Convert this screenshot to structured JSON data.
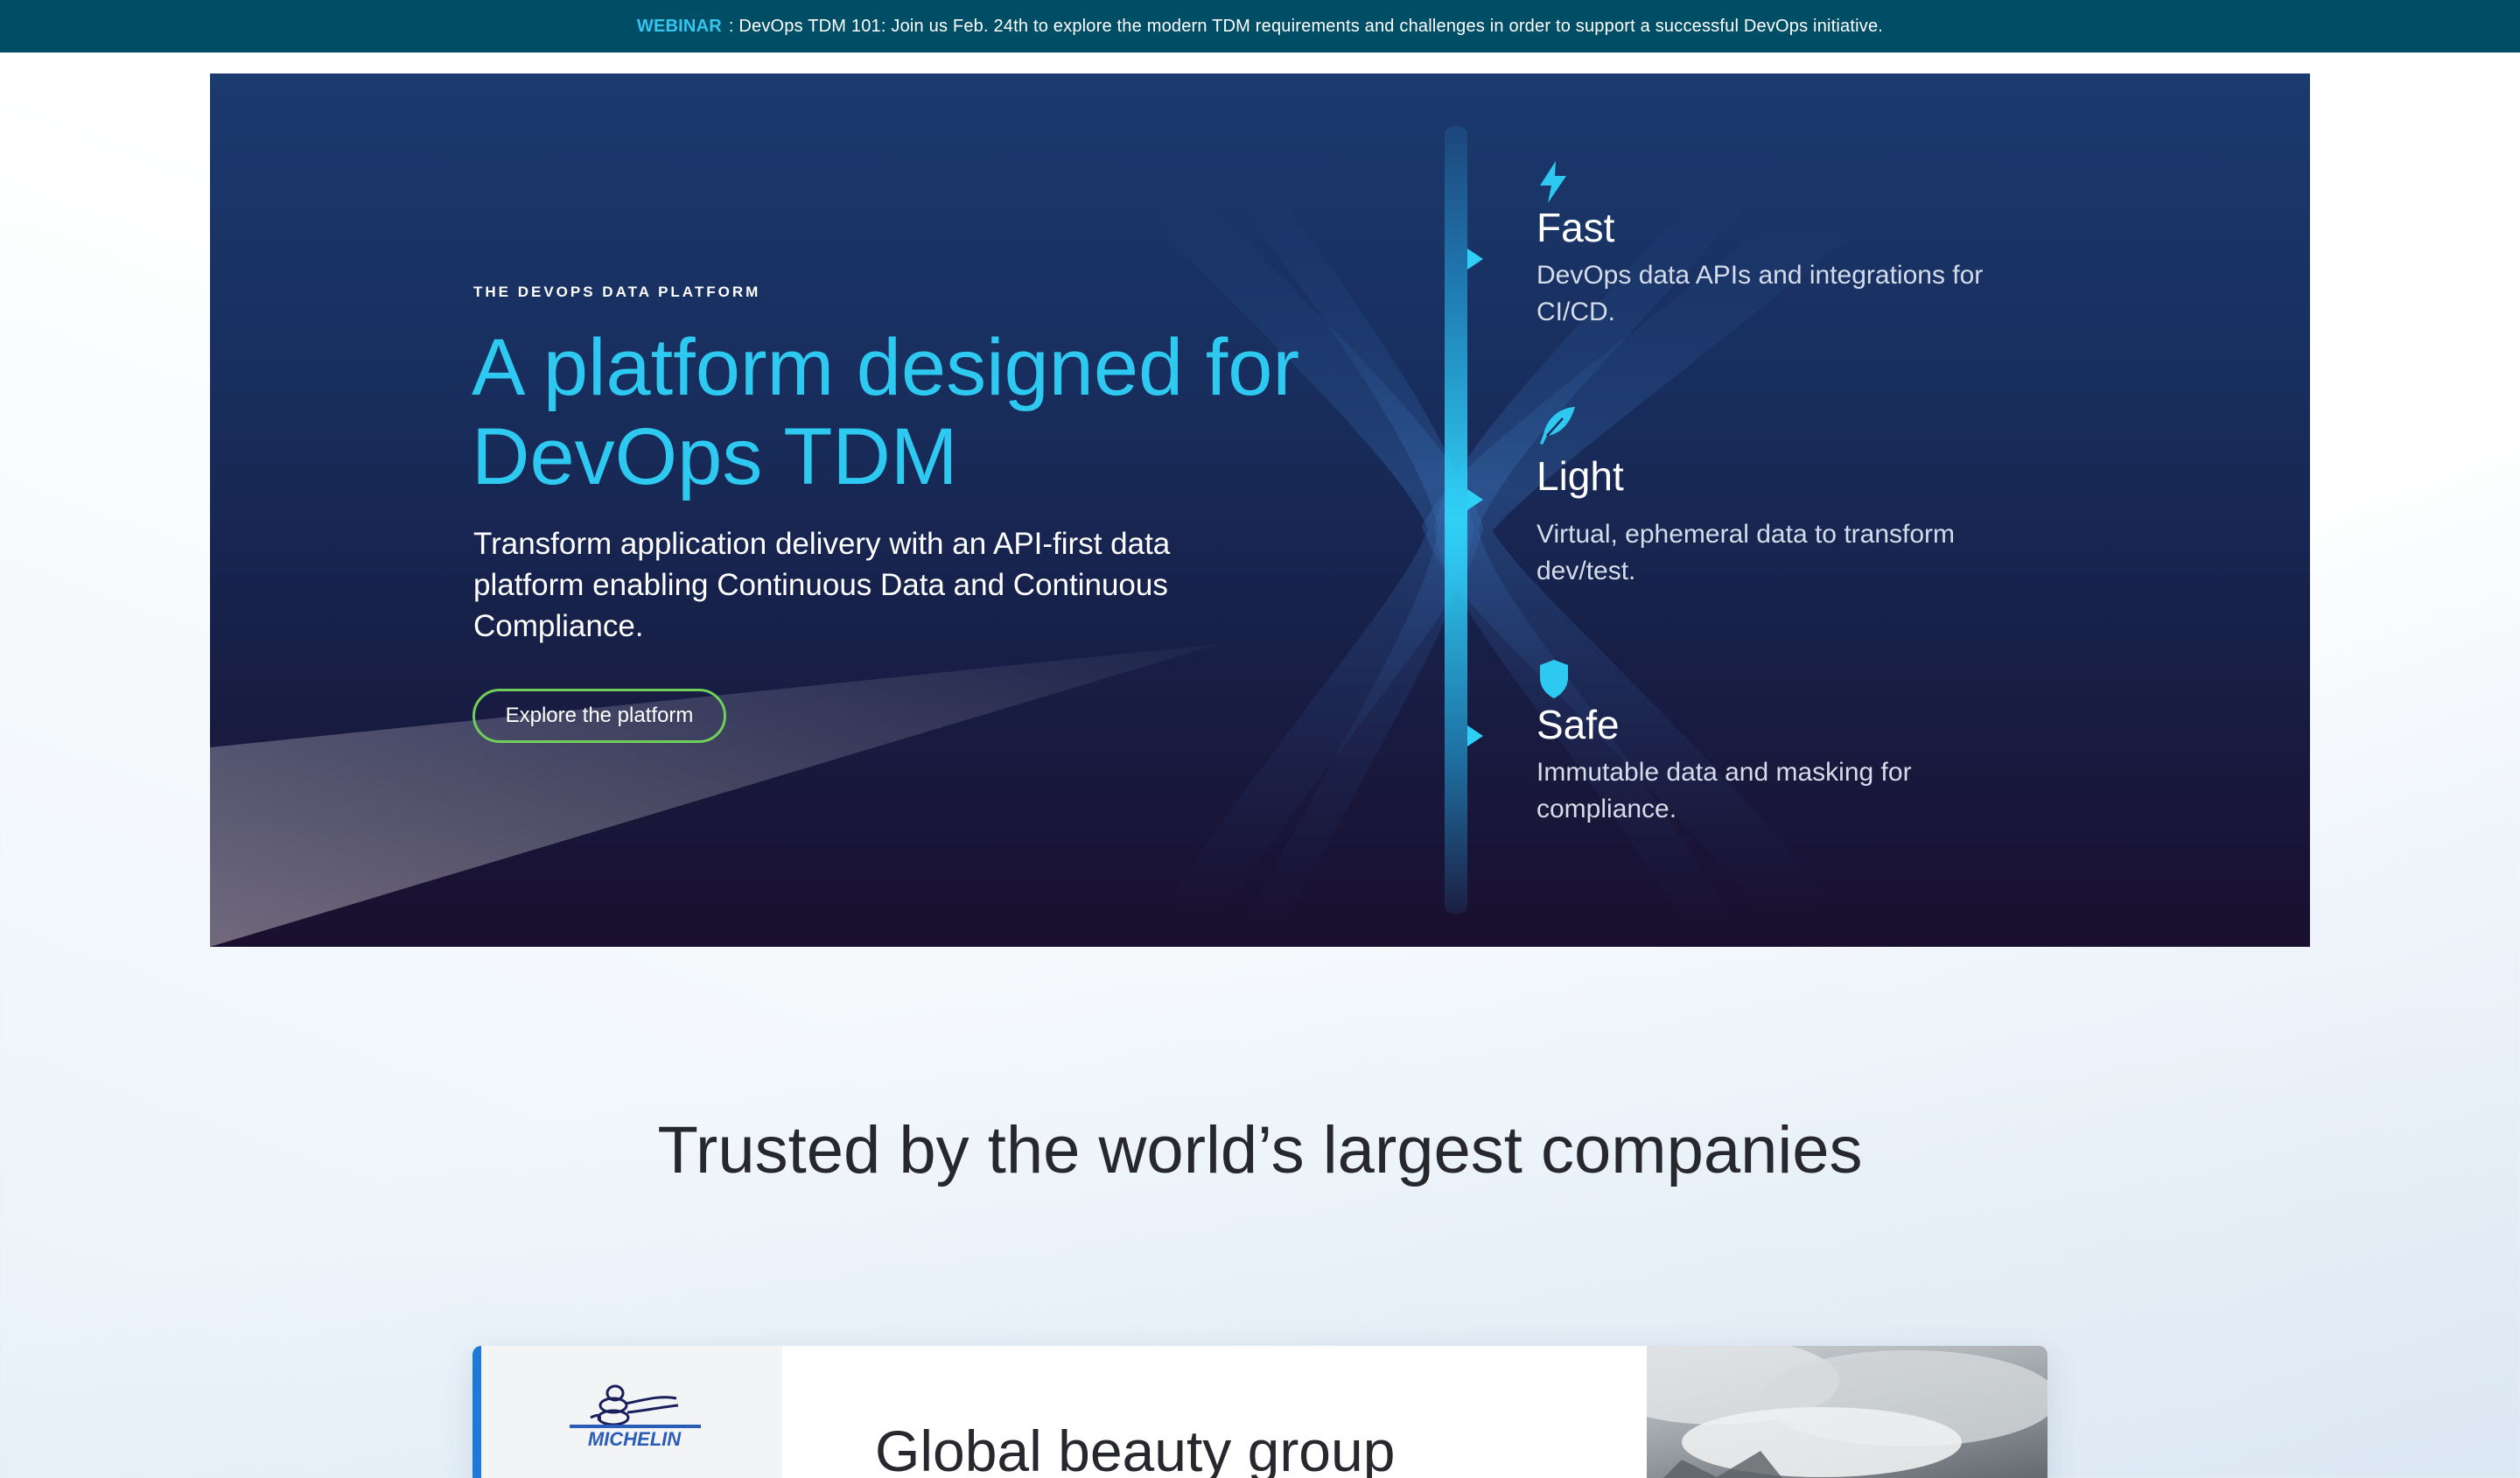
{
  "announcement": {
    "tag": "WEBINAR",
    "text": ": DevOps TDM 101: Join us Feb. 24th to explore the modern TDM requirements and challenges in order to support a successful DevOps initiative."
  },
  "hero": {
    "eyebrow": "THE DEVOPS DATA PLATFORM",
    "title": "A platform designed for DevOps TDM",
    "subtitle": "Transform application delivery with an API-first data platform enabling Continuous Data and Continuous Compliance.",
    "cta_label": "Explore the platform",
    "features": [
      {
        "icon": "lightning-icon",
        "name": "Fast",
        "desc": "DevOps data APIs and integrations for CI/CD."
      },
      {
        "icon": "feather-icon",
        "name": "Light",
        "desc": "Virtual, ephemeral data to transform dev/test."
      },
      {
        "icon": "shield-icon",
        "name": "Safe",
        "desc": "Immutable data and masking for compliance."
      }
    ]
  },
  "colors": {
    "announcement_bg": "#004d66",
    "accent_cyan": "#2ec9f0",
    "cta_border": "#6fcf5a",
    "card_accent": "#1f79d6"
  },
  "trusted": {
    "heading": "Trusted by the world’s largest companies"
  },
  "case_study": {
    "logo_text": "MICHELIN",
    "title": "Global beauty group"
  }
}
